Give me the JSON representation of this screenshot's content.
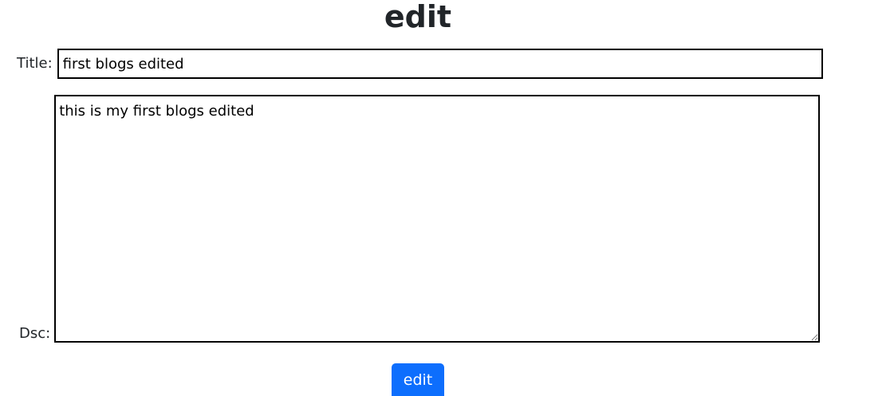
{
  "page": {
    "heading": "edit"
  },
  "form": {
    "title_label": "Title:",
    "title_value": "first blogs edited",
    "dsc_label": "Dsc:",
    "dsc_value": "this is my first blogs edited",
    "submit_label": "edit"
  },
  "colors": {
    "button_bg": "#0d6efd",
    "button_text": "#ffffff",
    "border": "#000000"
  }
}
